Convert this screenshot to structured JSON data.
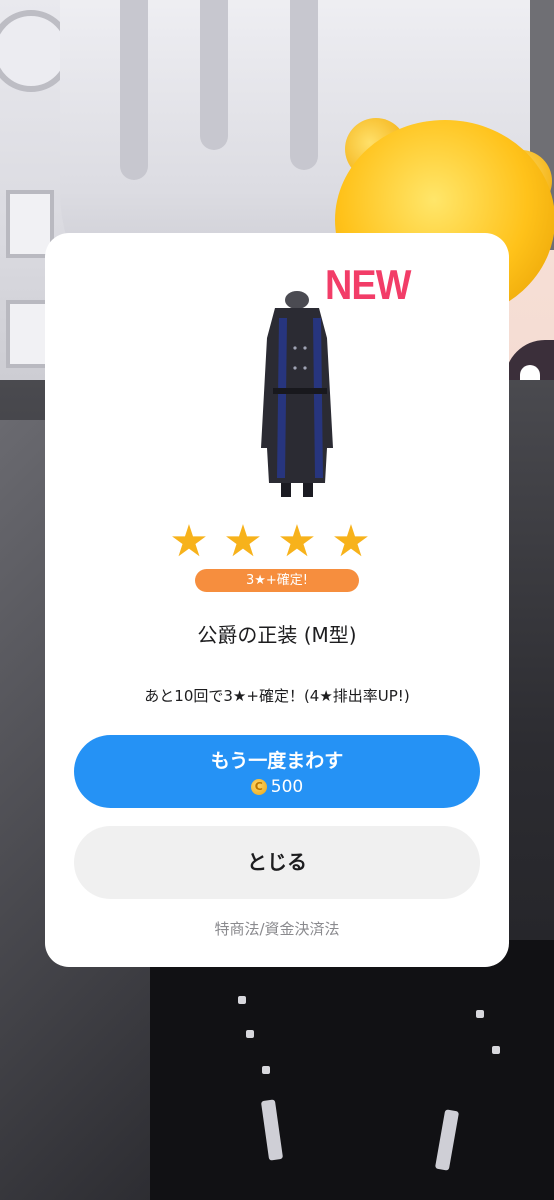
{
  "reward_dialog": {
    "new_badge": "NEW",
    "stars": [
      "★",
      "★",
      "★",
      "★"
    ],
    "guarantee_badge": "3★+確定!",
    "item_name": "公爵の正装 (M型)",
    "pity_text": "あと10回で3★+確定！(4★排出率UP!)",
    "spin_again": {
      "label": "もう一度まわす",
      "coin_symbol": "C",
      "cost": "500"
    },
    "close_label": "とじる",
    "legal_link": "特商法/資金決済法"
  },
  "colors": {
    "primary_button": "#2592f5",
    "secondary_button": "#f0f0f0",
    "star": "#f7b21b",
    "badge_orange": "#f68e3e",
    "new_red": "#f23d68"
  }
}
